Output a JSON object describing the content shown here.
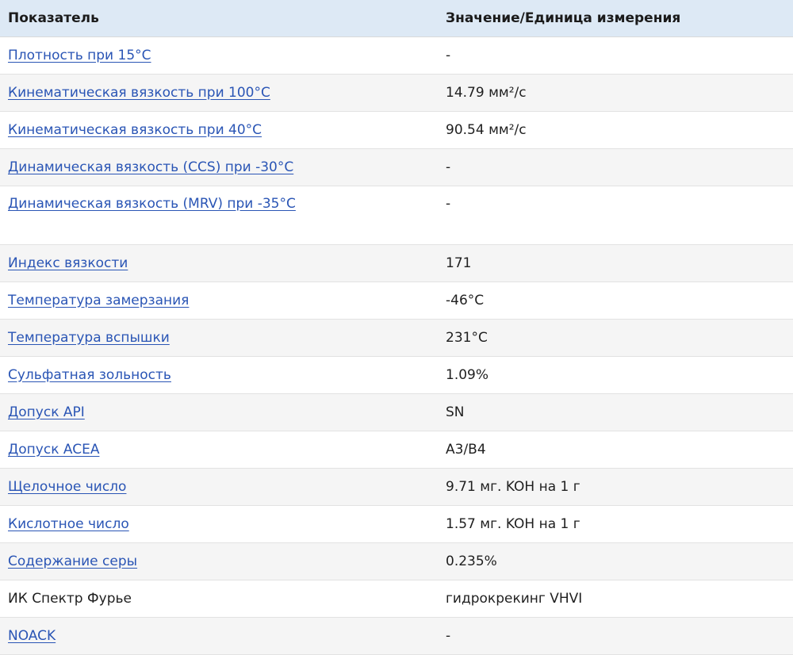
{
  "header": {
    "col1": "Показатель",
    "col2": "Значение/Единица измерения"
  },
  "rows": [
    {
      "name": "Плотность при 15°C",
      "value": "-",
      "link": true
    },
    {
      "name": "Кинематическая вязкость при 100°C",
      "value": "14.79 мм²/с",
      "link": true
    },
    {
      "name": "Кинематическая вязкость при 40°C",
      "value": "90.54 мм²/с",
      "link": true
    },
    {
      "name": "Динамическая вязкость (CCS) при -30°C",
      "value": "-",
      "link": true
    },
    {
      "name": "Динамическая вязкость (MRV) при -35°C",
      "value": "-",
      "link": true
    },
    {
      "name": "Индекс вязкости",
      "value": "171",
      "link": true
    },
    {
      "name": "Температура замерзания",
      "value": "-46°C",
      "link": true
    },
    {
      "name": "Температура вспышки",
      "value": "231°C",
      "link": true
    },
    {
      "name": "Сульфатная зольность",
      "value": "1.09%",
      "link": true
    },
    {
      "name": "Допуск API",
      "value": "SN",
      "link": true
    },
    {
      "name": "Допуск ACEA",
      "value": "A3/B4",
      "link": true
    },
    {
      "name": "Щелочное число",
      "value": "9.71 мг. KOH на 1 г",
      "link": true
    },
    {
      "name": "Кислотное число",
      "value": "1.57 мг. KOH на 1 г",
      "link": true
    },
    {
      "name": "Содержание серы",
      "value": "0.235%",
      "link": true
    },
    {
      "name": "ИК Спектр Фурье",
      "value": "гидрокрекинг VHVI",
      "link": false
    },
    {
      "name": "NOACK",
      "value": "-",
      "link": true
    }
  ],
  "colors": {
    "header_bg": "#dde9f5",
    "link": "#2a55b5",
    "alt_row_bg": "#f5f5f5"
  }
}
